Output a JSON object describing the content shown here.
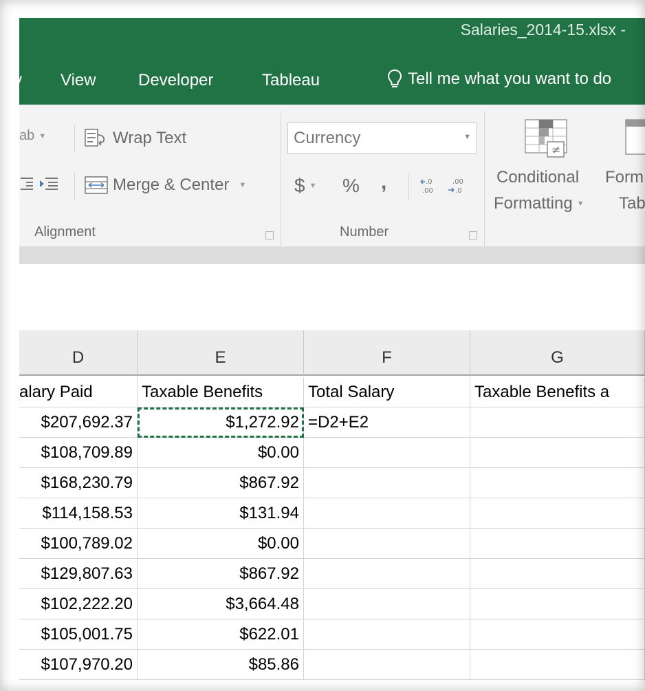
{
  "window": {
    "title": "Salaries_2014-15.xlsx -"
  },
  "tabs": [
    {
      "label": "y"
    },
    {
      "label": "View"
    },
    {
      "label": "Developer"
    },
    {
      "label": "Tableau"
    }
  ],
  "tell_me": {
    "label": "Tell me what you want to do"
  },
  "ribbon": {
    "alignment": {
      "wrap_text": "Wrap Text",
      "merge_center": "Merge & Center",
      "group_label": "Alignment"
    },
    "number": {
      "format_value": "Currency",
      "currency_symbol": "$",
      "percent_symbol": "%",
      "comma_symbol": "͗",
      "group_label": "Number"
    },
    "styles": {
      "conditional_line1": "Conditional",
      "conditional_line2": "Formatting",
      "format_table_line1": "Form",
      "format_table_line2": "Tab"
    }
  },
  "columns": [
    {
      "letter": "D",
      "header": "alary Paid"
    },
    {
      "letter": "E",
      "header": "Taxable Benefits"
    },
    {
      "letter": "F",
      "header": "Total Salary"
    },
    {
      "letter": "G",
      "header": "Taxable Benefits a"
    }
  ],
  "rows": [
    {
      "salary": "$207,692.37",
      "benefits": "$1,272.92",
      "total": "=D2+E2",
      "g": ""
    },
    {
      "salary": "$108,709.89",
      "benefits": "$0.00",
      "total": "",
      "g": ""
    },
    {
      "salary": "$168,230.79",
      "benefits": "$867.92",
      "total": "",
      "g": ""
    },
    {
      "salary": "$114,158.53",
      "benefits": "$131.94",
      "total": "",
      "g": ""
    },
    {
      "salary": "$100,789.02",
      "benefits": "$0.00",
      "total": "",
      "g": ""
    },
    {
      "salary": "$129,807.63",
      "benefits": "$867.92",
      "total": "",
      "g": ""
    },
    {
      "salary": "$102,222.20",
      "benefits": "$3,664.48",
      "total": "",
      "g": ""
    },
    {
      "salary": "$105,001.75",
      "benefits": "$622.01",
      "total": "",
      "g": ""
    },
    {
      "salary": "$107,970.20",
      "benefits": "$85.86",
      "total": "",
      "g": ""
    }
  ],
  "colors": {
    "excel_green": "#217346",
    "ribbon_bg": "#f3f3f3"
  }
}
